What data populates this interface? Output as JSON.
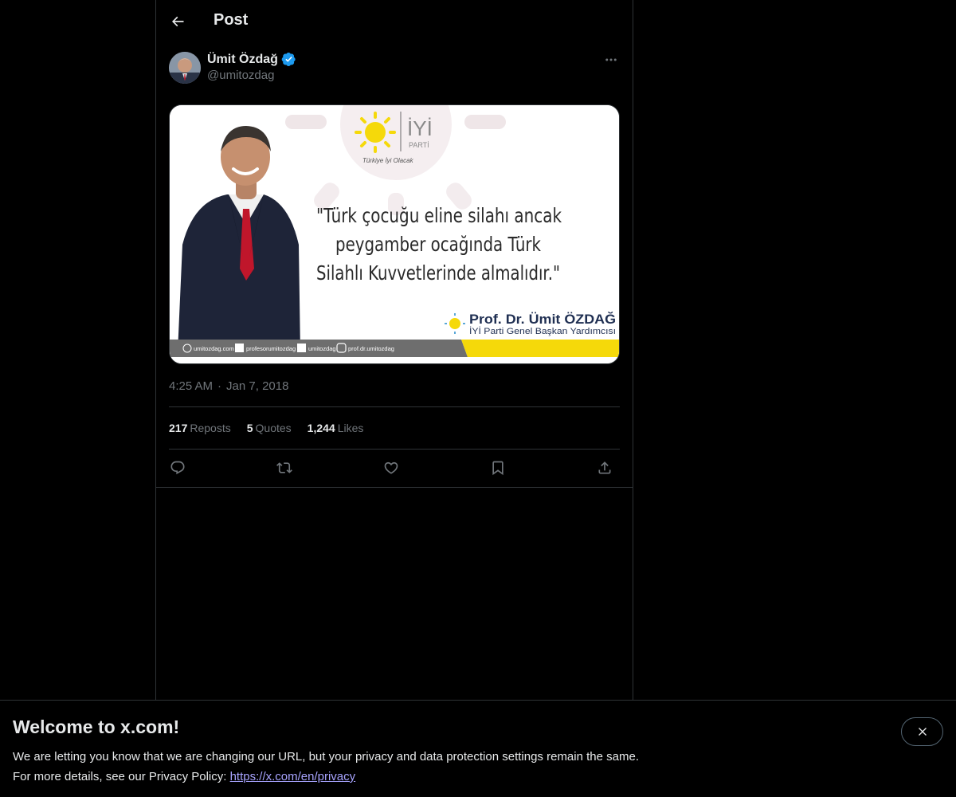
{
  "header": {
    "title": "Post"
  },
  "post": {
    "author_name": "Ümit Özdağ",
    "author_handle": "@umitozdag",
    "time": "4:25 AM",
    "separator": "·",
    "date": "Jan 7, 2018",
    "image": {
      "logo_text": "İYİ",
      "logo_sub": "PARTİ",
      "slogan": "Türkiye İyi Olacak",
      "quote_line1": "\"Türk çocuğu eline silahı ancak",
      "quote_line2": "peygamber ocağında Türk",
      "quote_line3": "Silahlı Kuvvetlerinde almalıdır.\"",
      "signature_name": "Prof. Dr. Ümit ÖZDAĞ",
      "signature_title": "İYİ Parti Genel Başkan Yardımcısı",
      "footer_website": "umitozdag.com",
      "footer_facebook": "profesorumitozdag",
      "footer_twitter": "umitozdag",
      "footer_instagram": "prof.dr.umitozdag"
    },
    "stats": {
      "reposts_count": "217",
      "reposts_label": "Reposts",
      "quotes_count": "5",
      "quotes_label": "Quotes",
      "likes_count": "1,244",
      "likes_label": "Likes"
    }
  },
  "banner": {
    "title": "Welcome to x.com!",
    "line1": "We are letting you know that we are changing our URL, but your privacy and data protection settings remain the same.",
    "line2_prefix": "For more details, see our Privacy Policy: ",
    "link_text": "https://x.com/en/privacy"
  },
  "colors": {
    "background": "#000000",
    "border": "#2f3336",
    "text_primary": "#e7e9ea",
    "text_secondary": "#71767b",
    "verified": "#1d9bf0",
    "link": "#a8a4ff",
    "party_yellow": "#f5d90a"
  },
  "icons": [
    "back-arrow-icon",
    "verified-badge-icon",
    "more-icon",
    "reply-icon",
    "repost-icon",
    "like-icon",
    "bookmark-icon",
    "share-icon",
    "close-icon"
  ]
}
